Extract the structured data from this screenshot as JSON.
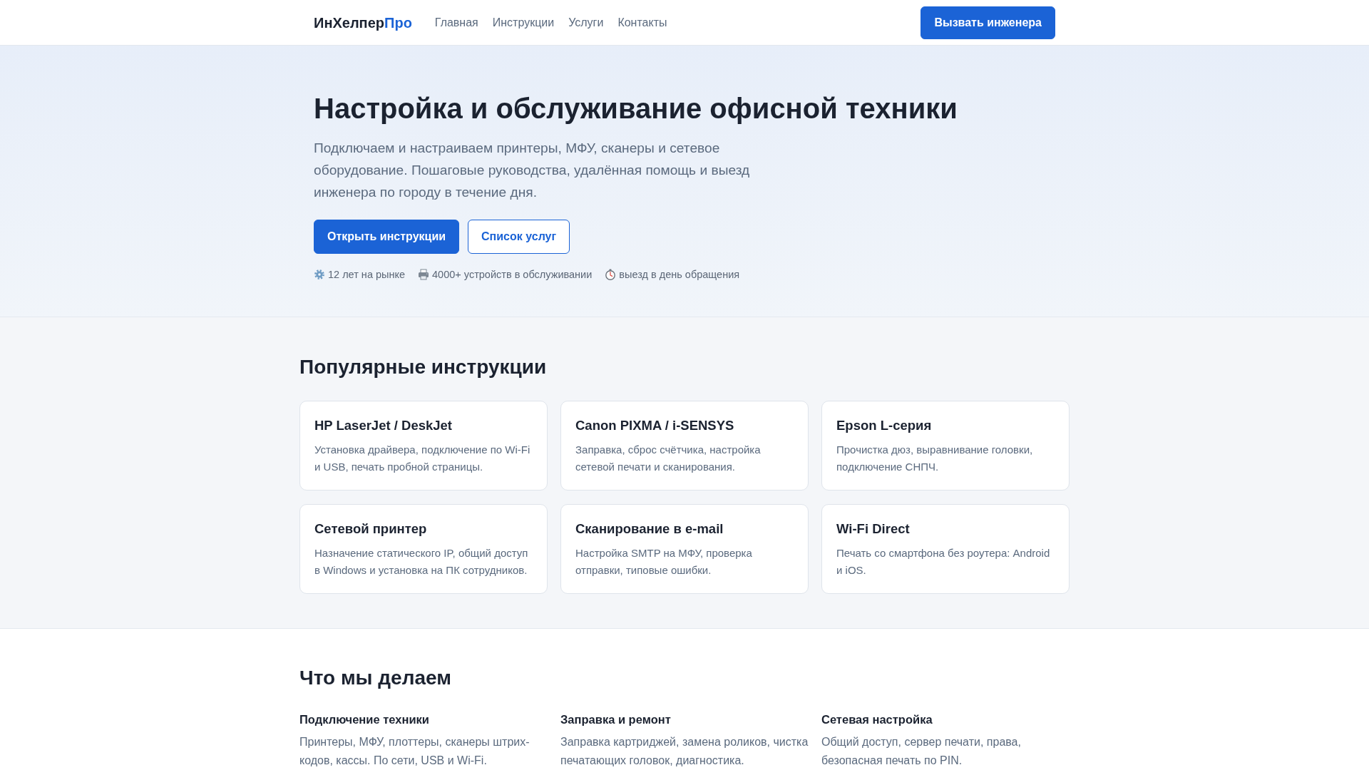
{
  "navbar": {
    "brand": "ИнХелпер",
    "brand_accent": "Про",
    "links": [
      "Главная",
      "Инструкции",
      "Услуги",
      "Контакты"
    ],
    "cta": "Вызвать инженера"
  },
  "hero": {
    "title": "Настройка и обслуживание офисной техники",
    "lead": "Подключаем и настраиваем принтеры, МФУ, сканеры и сетевое оборудование. Пошаговые руководства, удалённая помощь и выезд инженера по городу в течение дня.",
    "buttons": [
      {
        "label": "Открыть инструкции",
        "kind": "primary"
      },
      {
        "label": "Список услуг",
        "kind": "outline"
      }
    ],
    "stats": [
      {
        "kind": "gear",
        "text": "12 лет на рынке"
      },
      {
        "kind": "printer",
        "text": "4000+ устройств в обслуживании"
      },
      {
        "kind": "timer",
        "text": "выезд в день обращения"
      }
    ]
  },
  "instructions": {
    "title": "Популярные инструкции",
    "cards": [
      {
        "title": "HP LaserJet / DeskJet",
        "text": "Установка драйвера, подключение по Wi-Fi и USB, печать пробной страницы."
      },
      {
        "title": "Canon PIXMA / i-SENSYS",
        "text": "Заправка, сброс счётчика, настройка сетевой печати и сканирования."
      },
      {
        "title": "Epson L-серия",
        "text": "Прочистка дюз, выравнивание головки, подключение СНПЧ."
      },
      {
        "title": "Сетевой принтер",
        "text": "Назначение статического IP, общий доступ в Windows и установка на ПК сотрудников."
      },
      {
        "title": "Сканирование в e-mail",
        "text": "Настройка SMTP на МФУ, проверка отправки, типовые ошибки."
      },
      {
        "title": "Wi-Fi Direct",
        "text": "Печать со смартфона без роутера: Android и iOS."
      }
    ]
  },
  "services": {
    "title": "Что мы делаем",
    "items": [
      {
        "title": "Подключение техники",
        "text": "Принтеры, МФУ, плоттеры, сканеры штрих-кодов, кассы. По сети, USB и Wi-Fi."
      },
      {
        "title": "Заправка и ремонт",
        "text": "Заправка картриджей, замена роликов, чистка печатающих головок, диагностика."
      },
      {
        "title": "Сетевая настройка",
        "text": "Общий доступ, сервер печати, права, безопасная печать по PIN."
      }
    ]
  }
}
